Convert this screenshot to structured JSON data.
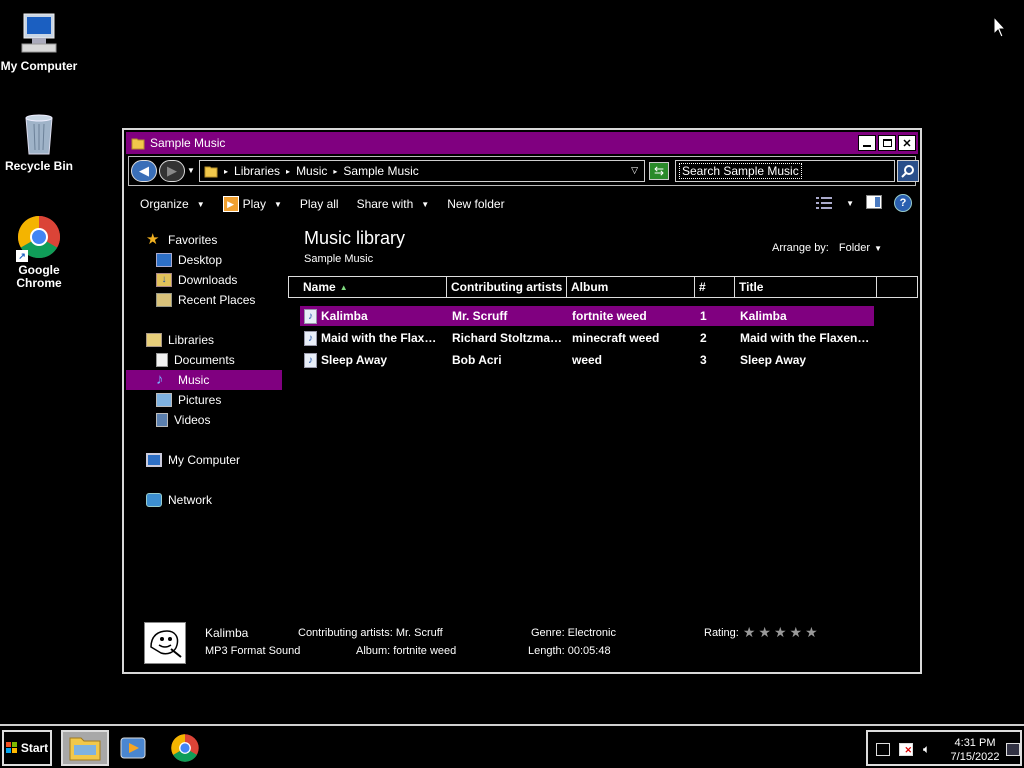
{
  "desktop": {
    "icons": [
      {
        "label": "My Computer",
        "icon": "my-computer-icon"
      },
      {
        "label": "Recycle Bin",
        "icon": "recycle-bin-icon"
      },
      {
        "label": "Google Chrome",
        "icon": "chrome-icon"
      }
    ]
  },
  "window": {
    "title": "Sample Music",
    "address": {
      "segments": [
        "Libraries",
        "Music",
        "Sample Music"
      ]
    },
    "search_placeholder": "Search Sample Music",
    "toolbar": {
      "organize": "Organize",
      "play": "Play",
      "play_all": "Play all",
      "share_with": "Share with",
      "new_folder": "New folder"
    },
    "nav": {
      "favorites": "Favorites",
      "desktop": "Desktop",
      "downloads": "Downloads",
      "recent_places": "Recent Places",
      "libraries": "Libraries",
      "documents": "Documents",
      "music": "Music",
      "pictures": "Pictures",
      "videos": "Videos",
      "my_computer": "My Computer",
      "network": "Network"
    },
    "library": {
      "title": "Music library",
      "subtitle": "Sample Music",
      "arrange_label": "Arrange by:",
      "arrange_value": "Folder"
    },
    "columns": [
      "Name",
      "Contributing artists",
      "Album",
      "#",
      "Title"
    ],
    "rows": [
      {
        "name": "Kalimba",
        "artist": "Mr. Scruff",
        "album": "fortnite weed",
        "num": "1",
        "title": "Kalimba",
        "selected": true
      },
      {
        "name": "Maid with the Flax…",
        "artist": "Richard Stoltzma…",
        "album": "minecraft weed",
        "num": "2",
        "title": "Maid with the Flaxen…",
        "selected": false
      },
      {
        "name": "Sleep Away",
        "artist": "Bob Acri",
        "album": "weed",
        "num": "3",
        "title": "Sleep Away",
        "selected": false
      }
    ],
    "details": {
      "name": "Kalimba",
      "type": "MP3 Format Sound",
      "artists": "Contributing artists: Mr. Scruff",
      "album": "Album: fortnite weed",
      "genre": "Genre: Electronic",
      "length": "Length: 00:05:48",
      "rating_label": "Rating:",
      "rating_stars": "★★★★★",
      "rating_value": 0
    }
  },
  "taskbar": {
    "start_label": "Start",
    "time": "4:31 PM",
    "date": "7/15/2022"
  },
  "colors": {
    "accent": "#800080",
    "background": "#000000",
    "text": "#ffffff"
  }
}
